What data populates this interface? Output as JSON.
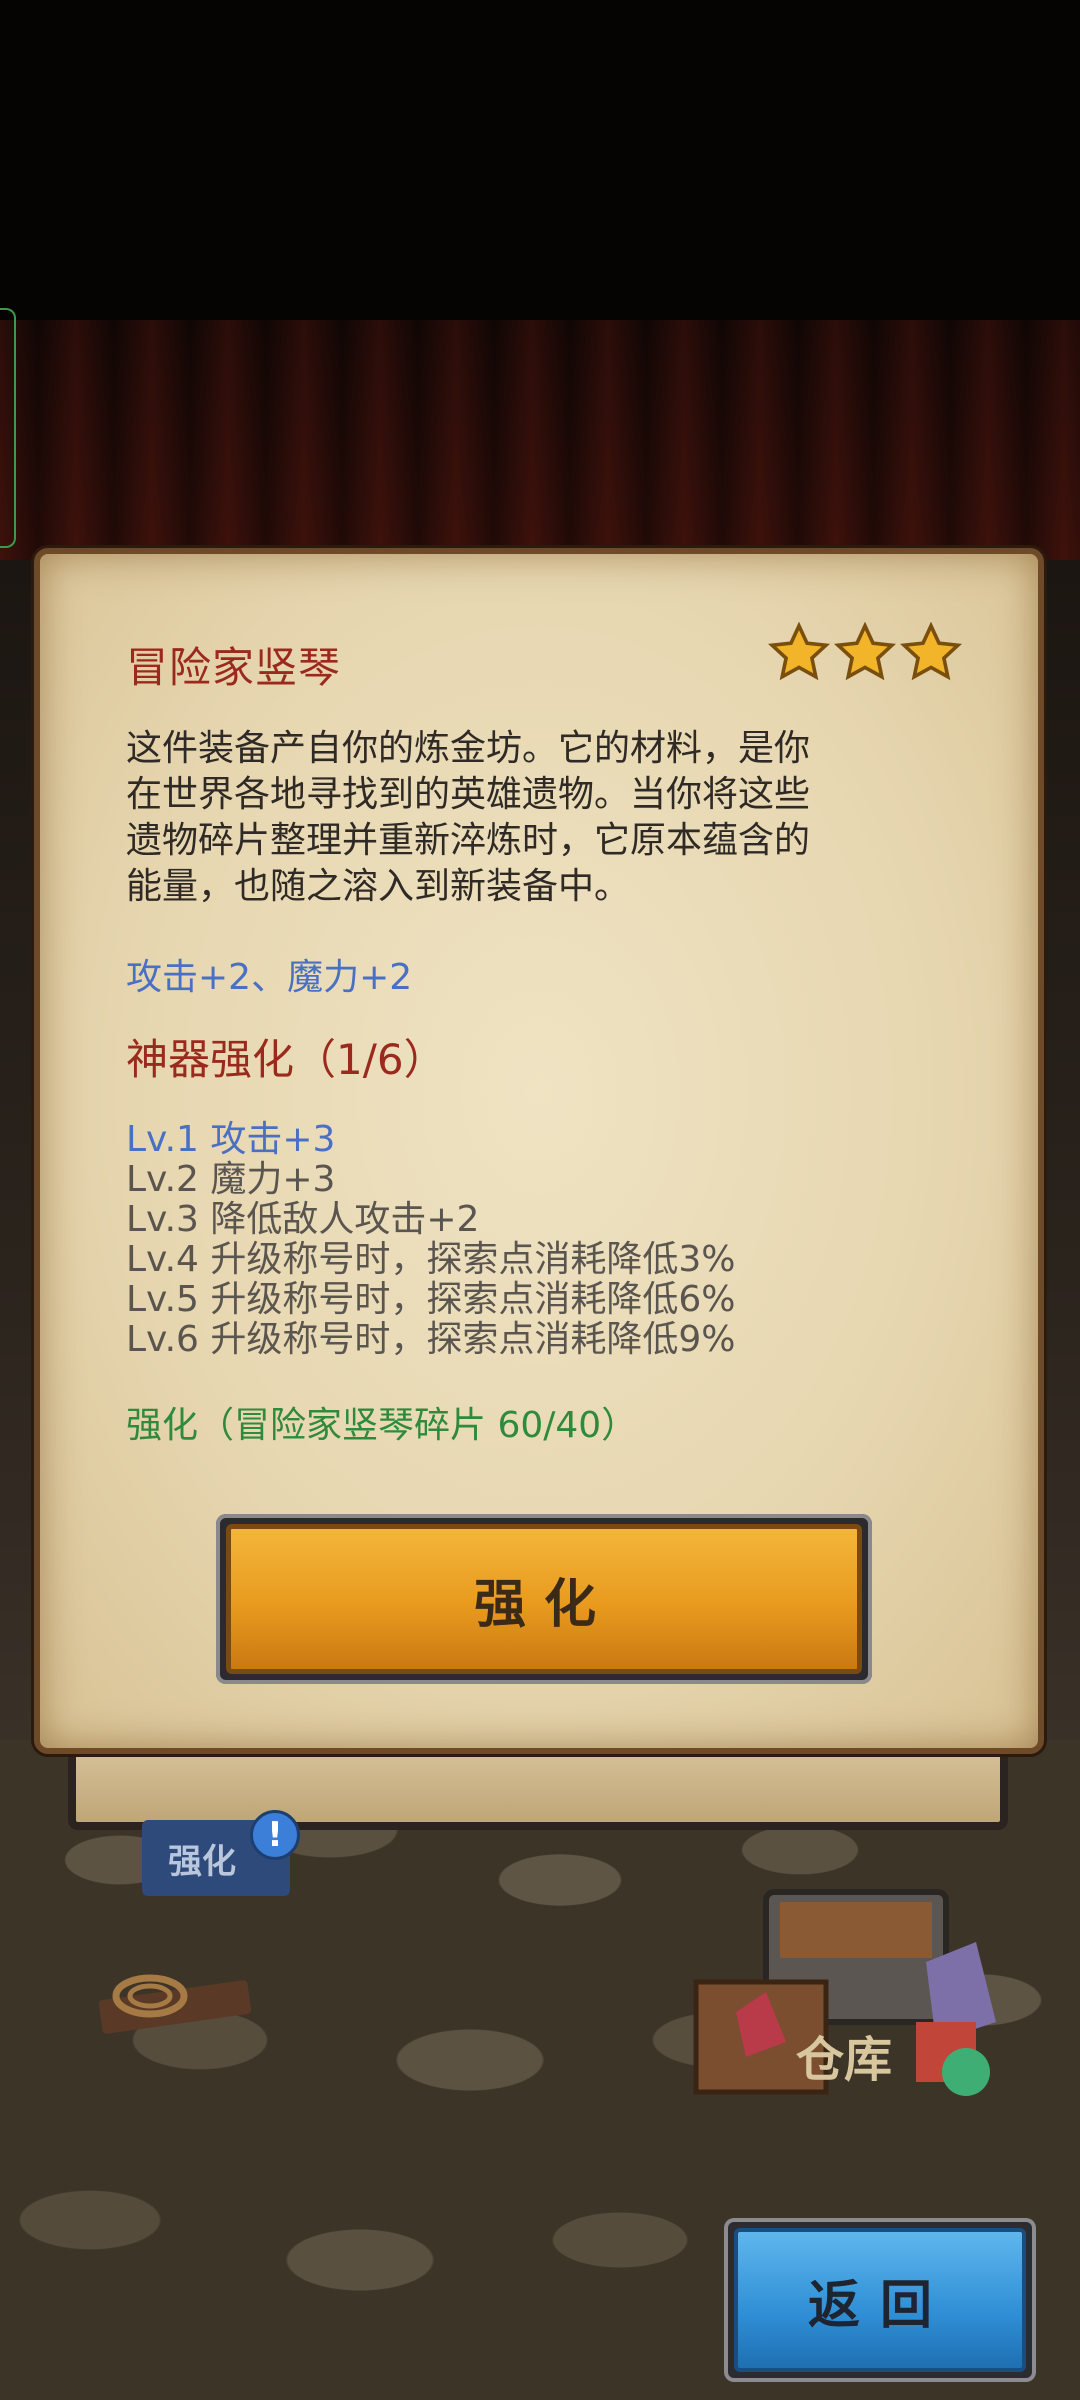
{
  "item": {
    "name": "冒险家竖琴",
    "star_count": 3,
    "description_lines": [
      "这件装备产自你的炼金坊。它的材料，是你",
      "在世界各地寻找到的英雄遗物。当你将这些",
      "遗物碎片整理并重新淬炼时，它原本蕴含的",
      "能量，也随之溶入到新装备中。"
    ],
    "stats": "攻击+2、魔力+2"
  },
  "artifact": {
    "title": "神器强化（1/6）",
    "levels": [
      {
        "text": "Lv.1 攻击+3",
        "active": true
      },
      {
        "text": "Lv.2 魔力+3",
        "active": false
      },
      {
        "text": "Lv.3 降低敌人攻击+2",
        "active": false
      },
      {
        "text": "Lv.4 升级称号时，探索点消耗降低3%",
        "active": false
      },
      {
        "text": "Lv.5 升级称号时，探索点消耗降低6%",
        "active": false
      },
      {
        "text": "Lv.6 升级称号时，探索点消耗降低9%",
        "active": false
      }
    ],
    "upgrade_info": "强化（冒险家竖琴碎片 60/40）"
  },
  "buttons": {
    "upgrade_label": "强化",
    "back_label": "返回"
  },
  "scene": {
    "upgrade_tag": "强化",
    "alert_mark": "!",
    "warehouse": "仓库"
  },
  "colors": {
    "title_red": "#9b2a1e",
    "stat_blue": "#4a70c4",
    "info_green": "#2f8a3c",
    "upgrade_orange": "#e89a1e",
    "back_blue": "#2f8fd6"
  }
}
